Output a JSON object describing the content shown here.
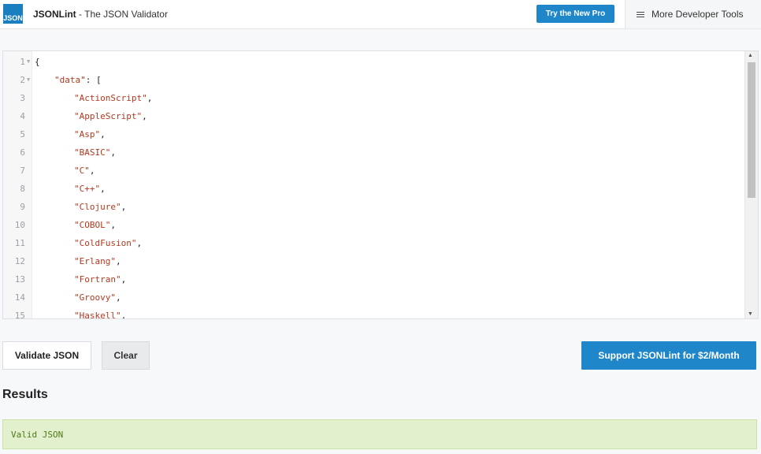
{
  "header": {
    "logo_text": "JSON",
    "brand_name": "JSONLint",
    "brand_tagline": " - The JSON Validator",
    "try_button": "Try the New Pro",
    "more_tools": "More Developer Tools"
  },
  "editor": {
    "lines": [
      {
        "num": "1",
        "fold": true,
        "parts": [
          {
            "t": "{",
            "s": false
          }
        ],
        "indent": 0
      },
      {
        "num": "2",
        "fold": true,
        "parts": [
          {
            "t": "\"data\"",
            "s": true
          },
          {
            "t": ": [",
            "s": false
          }
        ],
        "indent": 1
      },
      {
        "num": "3",
        "fold": false,
        "parts": [
          {
            "t": "\"ActionScript\"",
            "s": true
          },
          {
            "t": ",",
            "s": false
          }
        ],
        "indent": 2
      },
      {
        "num": "4",
        "fold": false,
        "parts": [
          {
            "t": "\"AppleScript\"",
            "s": true
          },
          {
            "t": ",",
            "s": false
          }
        ],
        "indent": 2
      },
      {
        "num": "5",
        "fold": false,
        "parts": [
          {
            "t": "\"Asp\"",
            "s": true
          },
          {
            "t": ",",
            "s": false
          }
        ],
        "indent": 2
      },
      {
        "num": "6",
        "fold": false,
        "parts": [
          {
            "t": "\"BASIC\"",
            "s": true
          },
          {
            "t": ",",
            "s": false
          }
        ],
        "indent": 2
      },
      {
        "num": "7",
        "fold": false,
        "parts": [
          {
            "t": "\"C\"",
            "s": true
          },
          {
            "t": ",",
            "s": false
          }
        ],
        "indent": 2
      },
      {
        "num": "8",
        "fold": false,
        "parts": [
          {
            "t": "\"C++\"",
            "s": true
          },
          {
            "t": ",",
            "s": false
          }
        ],
        "indent": 2
      },
      {
        "num": "9",
        "fold": false,
        "parts": [
          {
            "t": "\"Clojure\"",
            "s": true
          },
          {
            "t": ",",
            "s": false
          }
        ],
        "indent": 2
      },
      {
        "num": "10",
        "fold": false,
        "parts": [
          {
            "t": "\"COBOL\"",
            "s": true
          },
          {
            "t": ",",
            "s": false
          }
        ],
        "indent": 2
      },
      {
        "num": "11",
        "fold": false,
        "parts": [
          {
            "t": "\"ColdFusion\"",
            "s": true
          },
          {
            "t": ",",
            "s": false
          }
        ],
        "indent": 2
      },
      {
        "num": "12",
        "fold": false,
        "parts": [
          {
            "t": "\"Erlang\"",
            "s": true
          },
          {
            "t": ",",
            "s": false
          }
        ],
        "indent": 2
      },
      {
        "num": "13",
        "fold": false,
        "parts": [
          {
            "t": "\"Fortran\"",
            "s": true
          },
          {
            "t": ",",
            "s": false
          }
        ],
        "indent": 2
      },
      {
        "num": "14",
        "fold": false,
        "parts": [
          {
            "t": "\"Groovy\"",
            "s": true
          },
          {
            "t": ",",
            "s": false
          }
        ],
        "indent": 2
      },
      {
        "num": "15",
        "fold": false,
        "parts": [
          {
            "t": "\"Haskell\"",
            "s": true
          },
          {
            "t": ",",
            "s": false
          }
        ],
        "indent": 2
      }
    ]
  },
  "buttons": {
    "validate": "Validate JSON",
    "clear": "Clear",
    "support": "Support JSONLint for $2/Month"
  },
  "results": {
    "title": "Results",
    "message": "Valid JSON"
  },
  "colors": {
    "accent": "#1f87c9",
    "valid_bg": "#e2f0cd",
    "valid_text": "#4d7a1a",
    "string": "#b5381f"
  }
}
